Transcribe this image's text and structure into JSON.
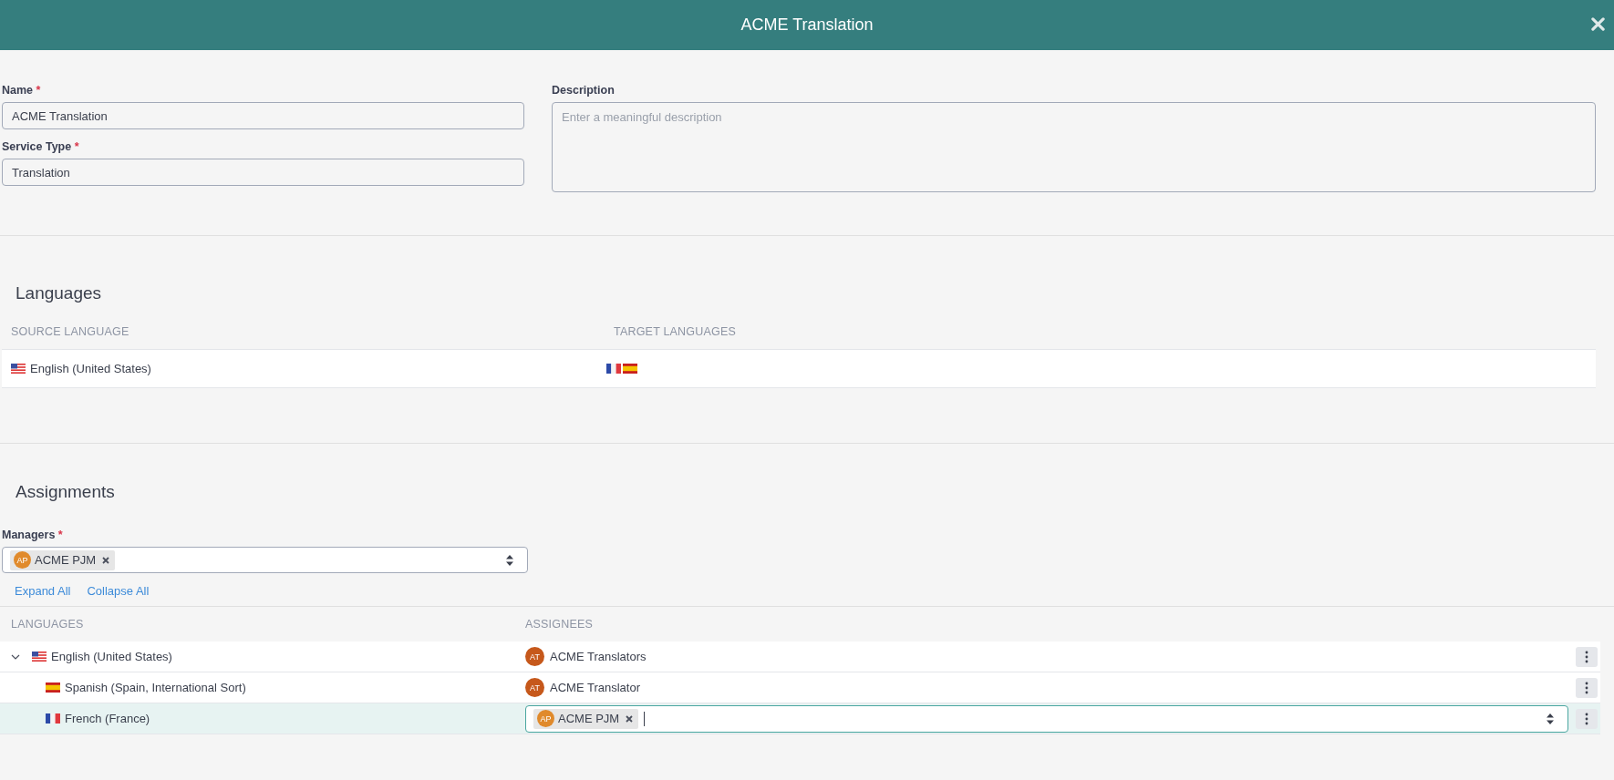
{
  "window": {
    "title": "ACME Translation"
  },
  "form": {
    "name": {
      "label": "Name",
      "required_mark": "*",
      "value": "ACME Translation"
    },
    "service_type": {
      "label": "Service Type",
      "required_mark": "*",
      "value": "Translation"
    },
    "description": {
      "label": "Description",
      "placeholder": "Enter a meaningful description"
    }
  },
  "languages": {
    "heading": "Languages",
    "columns": [
      "SOURCE LANGUAGE",
      "TARGET LANGUAGES"
    ],
    "source": {
      "flag": {
        "kind": "us"
      },
      "name": "English (United States)"
    },
    "targets": [
      {
        "kind": "fr"
      },
      {
        "kind": "es"
      }
    ]
  },
  "assignments": {
    "heading": "Assignments",
    "managers": {
      "label": "Managers",
      "required_mark": "*",
      "tags": [
        {
          "initials": "AP",
          "name": "ACME PJM"
        }
      ]
    },
    "links": [
      "Expand All",
      "Collapse All"
    ],
    "columns": [
      "LANGUAGES",
      "ASSIGNEES"
    ],
    "rows": [
      {
        "flag": {
          "kind": "us"
        },
        "name": "English (United States)",
        "expanded": true,
        "selected": false,
        "assignee": {
          "kind": "avatar",
          "initials": "AT",
          "name": "ACME Translators"
        },
        "children": [
          {
            "flag": {
              "kind": "es"
            },
            "name": "Spanish (Spain, International Sort)",
            "selected": false,
            "assignee": {
              "kind": "avatar",
              "initials": "AT",
              "name": "ACME Translator"
            }
          },
          {
            "flag": {
              "kind": "fr"
            },
            "name": "French (France)",
            "selected": true,
            "assignee": {
              "kind": "select",
              "tags": [
                {
                  "initials": "AP",
                  "name": "ACME PJM"
                }
              ]
            }
          }
        ]
      }
    ]
  }
}
